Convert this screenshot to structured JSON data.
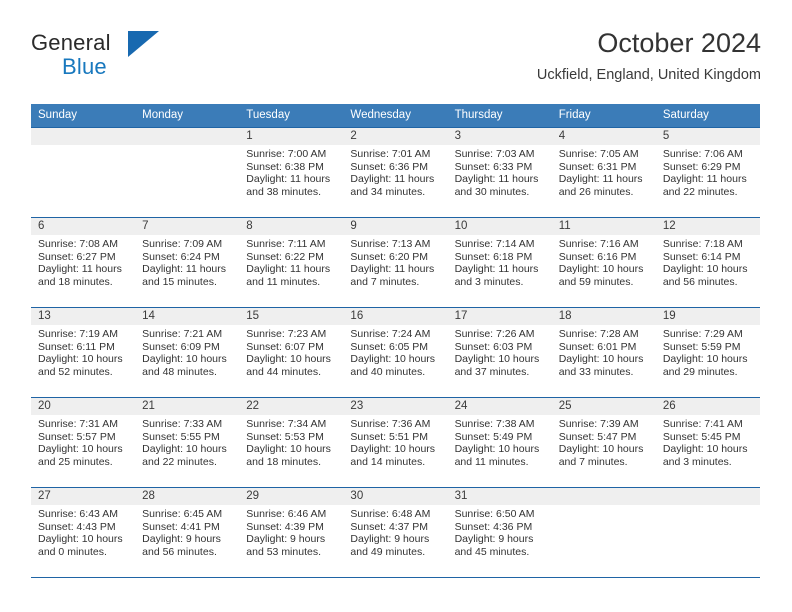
{
  "brand": {
    "name_top": "General",
    "name_bottom": "Blue",
    "accent_color": "#1869b0",
    "logo_icon": "triangle-logo-icon"
  },
  "header": {
    "title": "October 2024",
    "location": "Uckfield, England, United Kingdom"
  },
  "calendar": {
    "header_bg": "#3b7cb8",
    "row_border_color": "#1f64a5",
    "daynum_bg": "#efefef",
    "weekdays": [
      "Sunday",
      "Monday",
      "Tuesday",
      "Wednesday",
      "Thursday",
      "Friday",
      "Saturday"
    ],
    "weeks": [
      [
        {
          "day": "",
          "empty": true
        },
        {
          "day": "",
          "empty": true
        },
        {
          "day": "1",
          "sunrise": "Sunrise: 7:00 AM",
          "sunset": "Sunset: 6:38 PM",
          "daylight": "Daylight: 11 hours and 38 minutes."
        },
        {
          "day": "2",
          "sunrise": "Sunrise: 7:01 AM",
          "sunset": "Sunset: 6:36 PM",
          "daylight": "Daylight: 11 hours and 34 minutes."
        },
        {
          "day": "3",
          "sunrise": "Sunrise: 7:03 AM",
          "sunset": "Sunset: 6:33 PM",
          "daylight": "Daylight: 11 hours and 30 minutes."
        },
        {
          "day": "4",
          "sunrise": "Sunrise: 7:05 AM",
          "sunset": "Sunset: 6:31 PM",
          "daylight": "Daylight: 11 hours and 26 minutes."
        },
        {
          "day": "5",
          "sunrise": "Sunrise: 7:06 AM",
          "sunset": "Sunset: 6:29 PM",
          "daylight": "Daylight: 11 hours and 22 minutes."
        }
      ],
      [
        {
          "day": "6",
          "sunrise": "Sunrise: 7:08 AM",
          "sunset": "Sunset: 6:27 PM",
          "daylight": "Daylight: 11 hours and 18 minutes."
        },
        {
          "day": "7",
          "sunrise": "Sunrise: 7:09 AM",
          "sunset": "Sunset: 6:24 PM",
          "daylight": "Daylight: 11 hours and 15 minutes."
        },
        {
          "day": "8",
          "sunrise": "Sunrise: 7:11 AM",
          "sunset": "Sunset: 6:22 PM",
          "daylight": "Daylight: 11 hours and 11 minutes."
        },
        {
          "day": "9",
          "sunrise": "Sunrise: 7:13 AM",
          "sunset": "Sunset: 6:20 PM",
          "daylight": "Daylight: 11 hours and 7 minutes."
        },
        {
          "day": "10",
          "sunrise": "Sunrise: 7:14 AM",
          "sunset": "Sunset: 6:18 PM",
          "daylight": "Daylight: 11 hours and 3 minutes."
        },
        {
          "day": "11",
          "sunrise": "Sunrise: 7:16 AM",
          "sunset": "Sunset: 6:16 PM",
          "daylight": "Daylight: 10 hours and 59 minutes."
        },
        {
          "day": "12",
          "sunrise": "Sunrise: 7:18 AM",
          "sunset": "Sunset: 6:14 PM",
          "daylight": "Daylight: 10 hours and 56 minutes."
        }
      ],
      [
        {
          "day": "13",
          "sunrise": "Sunrise: 7:19 AM",
          "sunset": "Sunset: 6:11 PM",
          "daylight": "Daylight: 10 hours and 52 minutes."
        },
        {
          "day": "14",
          "sunrise": "Sunrise: 7:21 AM",
          "sunset": "Sunset: 6:09 PM",
          "daylight": "Daylight: 10 hours and 48 minutes."
        },
        {
          "day": "15",
          "sunrise": "Sunrise: 7:23 AM",
          "sunset": "Sunset: 6:07 PM",
          "daylight": "Daylight: 10 hours and 44 minutes."
        },
        {
          "day": "16",
          "sunrise": "Sunrise: 7:24 AM",
          "sunset": "Sunset: 6:05 PM",
          "daylight": "Daylight: 10 hours and 40 minutes."
        },
        {
          "day": "17",
          "sunrise": "Sunrise: 7:26 AM",
          "sunset": "Sunset: 6:03 PM",
          "daylight": "Daylight: 10 hours and 37 minutes."
        },
        {
          "day": "18",
          "sunrise": "Sunrise: 7:28 AM",
          "sunset": "Sunset: 6:01 PM",
          "daylight": "Daylight: 10 hours and 33 minutes."
        },
        {
          "day": "19",
          "sunrise": "Sunrise: 7:29 AM",
          "sunset": "Sunset: 5:59 PM",
          "daylight": "Daylight: 10 hours and 29 minutes."
        }
      ],
      [
        {
          "day": "20",
          "sunrise": "Sunrise: 7:31 AM",
          "sunset": "Sunset: 5:57 PM",
          "daylight": "Daylight: 10 hours and 25 minutes."
        },
        {
          "day": "21",
          "sunrise": "Sunrise: 7:33 AM",
          "sunset": "Sunset: 5:55 PM",
          "daylight": "Daylight: 10 hours and 22 minutes."
        },
        {
          "day": "22",
          "sunrise": "Sunrise: 7:34 AM",
          "sunset": "Sunset: 5:53 PM",
          "daylight": "Daylight: 10 hours and 18 minutes."
        },
        {
          "day": "23",
          "sunrise": "Sunrise: 7:36 AM",
          "sunset": "Sunset: 5:51 PM",
          "daylight": "Daylight: 10 hours and 14 minutes."
        },
        {
          "day": "24",
          "sunrise": "Sunrise: 7:38 AM",
          "sunset": "Sunset: 5:49 PM",
          "daylight": "Daylight: 10 hours and 11 minutes."
        },
        {
          "day": "25",
          "sunrise": "Sunrise: 7:39 AM",
          "sunset": "Sunset: 5:47 PM",
          "daylight": "Daylight: 10 hours and 7 minutes."
        },
        {
          "day": "26",
          "sunrise": "Sunrise: 7:41 AM",
          "sunset": "Sunset: 5:45 PM",
          "daylight": "Daylight: 10 hours and 3 minutes."
        }
      ],
      [
        {
          "day": "27",
          "sunrise": "Sunrise: 6:43 AM",
          "sunset": "Sunset: 4:43 PM",
          "daylight": "Daylight: 10 hours and 0 minutes."
        },
        {
          "day": "28",
          "sunrise": "Sunrise: 6:45 AM",
          "sunset": "Sunset: 4:41 PM",
          "daylight": "Daylight: 9 hours and 56 minutes."
        },
        {
          "day": "29",
          "sunrise": "Sunrise: 6:46 AM",
          "sunset": "Sunset: 4:39 PM",
          "daylight": "Daylight: 9 hours and 53 minutes."
        },
        {
          "day": "30",
          "sunrise": "Sunrise: 6:48 AM",
          "sunset": "Sunset: 4:37 PM",
          "daylight": "Daylight: 9 hours and 49 minutes."
        },
        {
          "day": "31",
          "sunrise": "Sunrise: 6:50 AM",
          "sunset": "Sunset: 4:36 PM",
          "daylight": "Daylight: 9 hours and 45 minutes."
        },
        {
          "day": "",
          "empty": true
        },
        {
          "day": "",
          "empty": true
        }
      ]
    ]
  }
}
